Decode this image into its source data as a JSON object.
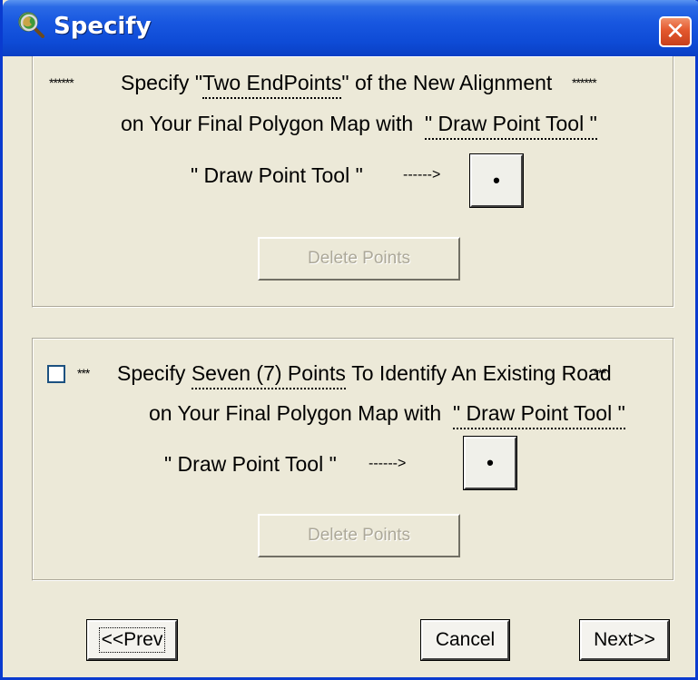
{
  "window": {
    "title": "Specify",
    "close_label": "✕"
  },
  "section1": {
    "stars_left": "******",
    "line1_a": "Specify \"",
    "line1_b": "Two EndPoints",
    "line1_c": "\" of the  New Alignment",
    "stars_right": "******",
    "line2_a": "on Your Final Polygon Map with",
    "line2_b": "\" Draw Point Tool \"",
    "tool_label": "\" Draw Point Tool \"",
    "arrow": "------>",
    "tool_button_glyph": "•",
    "delete_label": "Delete Points"
  },
  "section2": {
    "checked": false,
    "stars_left": "***",
    "line1_a": "Specify",
    "line1_b": "Seven (7) Points",
    "line1_c": "To Identify An Existing Road",
    "stars_right": "***",
    "line2_a": "on Your Final Polygon Map with",
    "line2_b": "\" Draw Point Tool \"",
    "tool_label": "\" Draw Point Tool \"",
    "arrow": "------>",
    "tool_button_glyph": "•",
    "delete_label": "Delete Points"
  },
  "footer": {
    "prev_label": "<<Prev",
    "cancel_label": "Cancel",
    "next_label": "Next>>"
  },
  "colors": {
    "titlebar": "#0e4bd6",
    "face": "#ece9d8",
    "close": "#e3582d"
  }
}
